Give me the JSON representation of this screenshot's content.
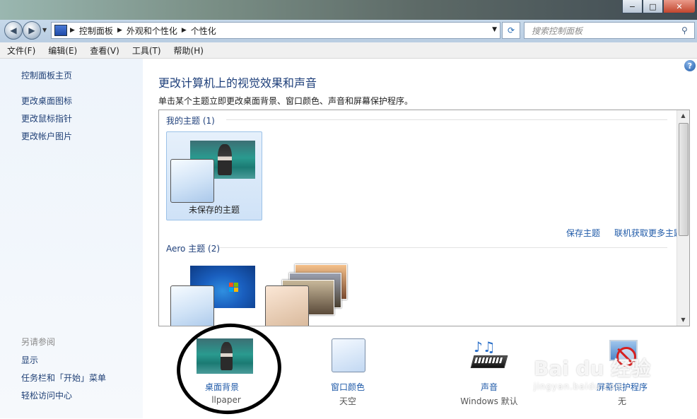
{
  "window": {
    "min_label": "−",
    "max_label": "□",
    "close_label": "✕"
  },
  "address": {
    "crumbs": [
      "控制面板",
      "外观和个性化",
      "个性化"
    ],
    "search_placeholder": "搜索控制面板"
  },
  "menu": [
    "文件(F)",
    "编辑(E)",
    "查看(V)",
    "工具(T)",
    "帮助(H)"
  ],
  "sidebar": {
    "links": [
      "控制面板主页",
      "更改桌面图标",
      "更改鼠标指针",
      "更改帐户图片"
    ],
    "see_also_label": "另请参阅",
    "see_also": [
      "显示",
      "任务栏和「开始」菜单",
      "轻松访问中心"
    ]
  },
  "main": {
    "heading": "更改计算机上的视觉效果和声音",
    "subtitle": "单击某个主题立即更改桌面背景、窗口颜色、声音和屏幕保护程序。",
    "my_themes_label": "我的主题 (1)",
    "unsaved_theme": "未保存的主题",
    "save_theme": "保存主题",
    "get_more_themes": "联机获取更多主题",
    "aero_label": "Aero 主题 (2)"
  },
  "bottom": {
    "items": [
      {
        "label": "桌面背景",
        "sub": "llpaper"
      },
      {
        "label": "窗口颜色",
        "sub": "天空"
      },
      {
        "label": "声音",
        "sub": "Windows 默认"
      },
      {
        "label": "屏幕保护程序",
        "sub": "无"
      }
    ]
  },
  "watermark": {
    "brand": "Bai du 经验",
    "site": "jingyan.baidu.com"
  },
  "colors": {
    "link": "#1f5aa8",
    "heading": "#1e3f7a"
  }
}
